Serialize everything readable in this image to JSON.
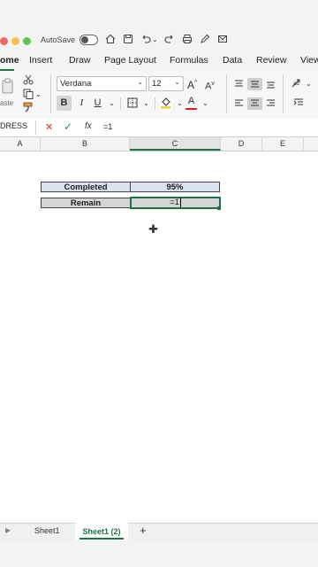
{
  "titlebar": {
    "autosave_label": "AutoSave",
    "autosave_on": false,
    "icons": [
      "home-icon",
      "save-icon",
      "undo-icon",
      "redo-icon",
      "print-icon",
      "pen-icon",
      "mail-icon",
      "more-icon"
    ],
    "more_glyph": "···"
  },
  "ribbon_tabs": [
    {
      "label": "ome"
    },
    {
      "label": "Insert"
    },
    {
      "label": "Draw"
    },
    {
      "label": "Page Layout"
    },
    {
      "label": "Formulas"
    },
    {
      "label": "Data"
    },
    {
      "label": "Review"
    },
    {
      "label": "View"
    }
  ],
  "ribbon": {
    "paste_label": "aste",
    "font_name": "Verdana",
    "font_size": "12",
    "grow_font": "A",
    "shrink_font": "A",
    "bold": "B",
    "italic": "I",
    "underline": "U",
    "font_color_label": "A",
    "accent_color": "#1e7145"
  },
  "formula_bar": {
    "name_box": "DRESS",
    "fx": "fx",
    "content": "=1"
  },
  "columns": [
    "A",
    "B",
    "C",
    "D",
    "E"
  ],
  "selected_column": "C",
  "cells": {
    "b1": "Completed",
    "c1": "95%",
    "b2": "Remain",
    "c2": "=1"
  },
  "sheets": {
    "sheet1": "Sheet1",
    "sheet2": "Sheet1 (2)",
    "add": "+"
  }
}
